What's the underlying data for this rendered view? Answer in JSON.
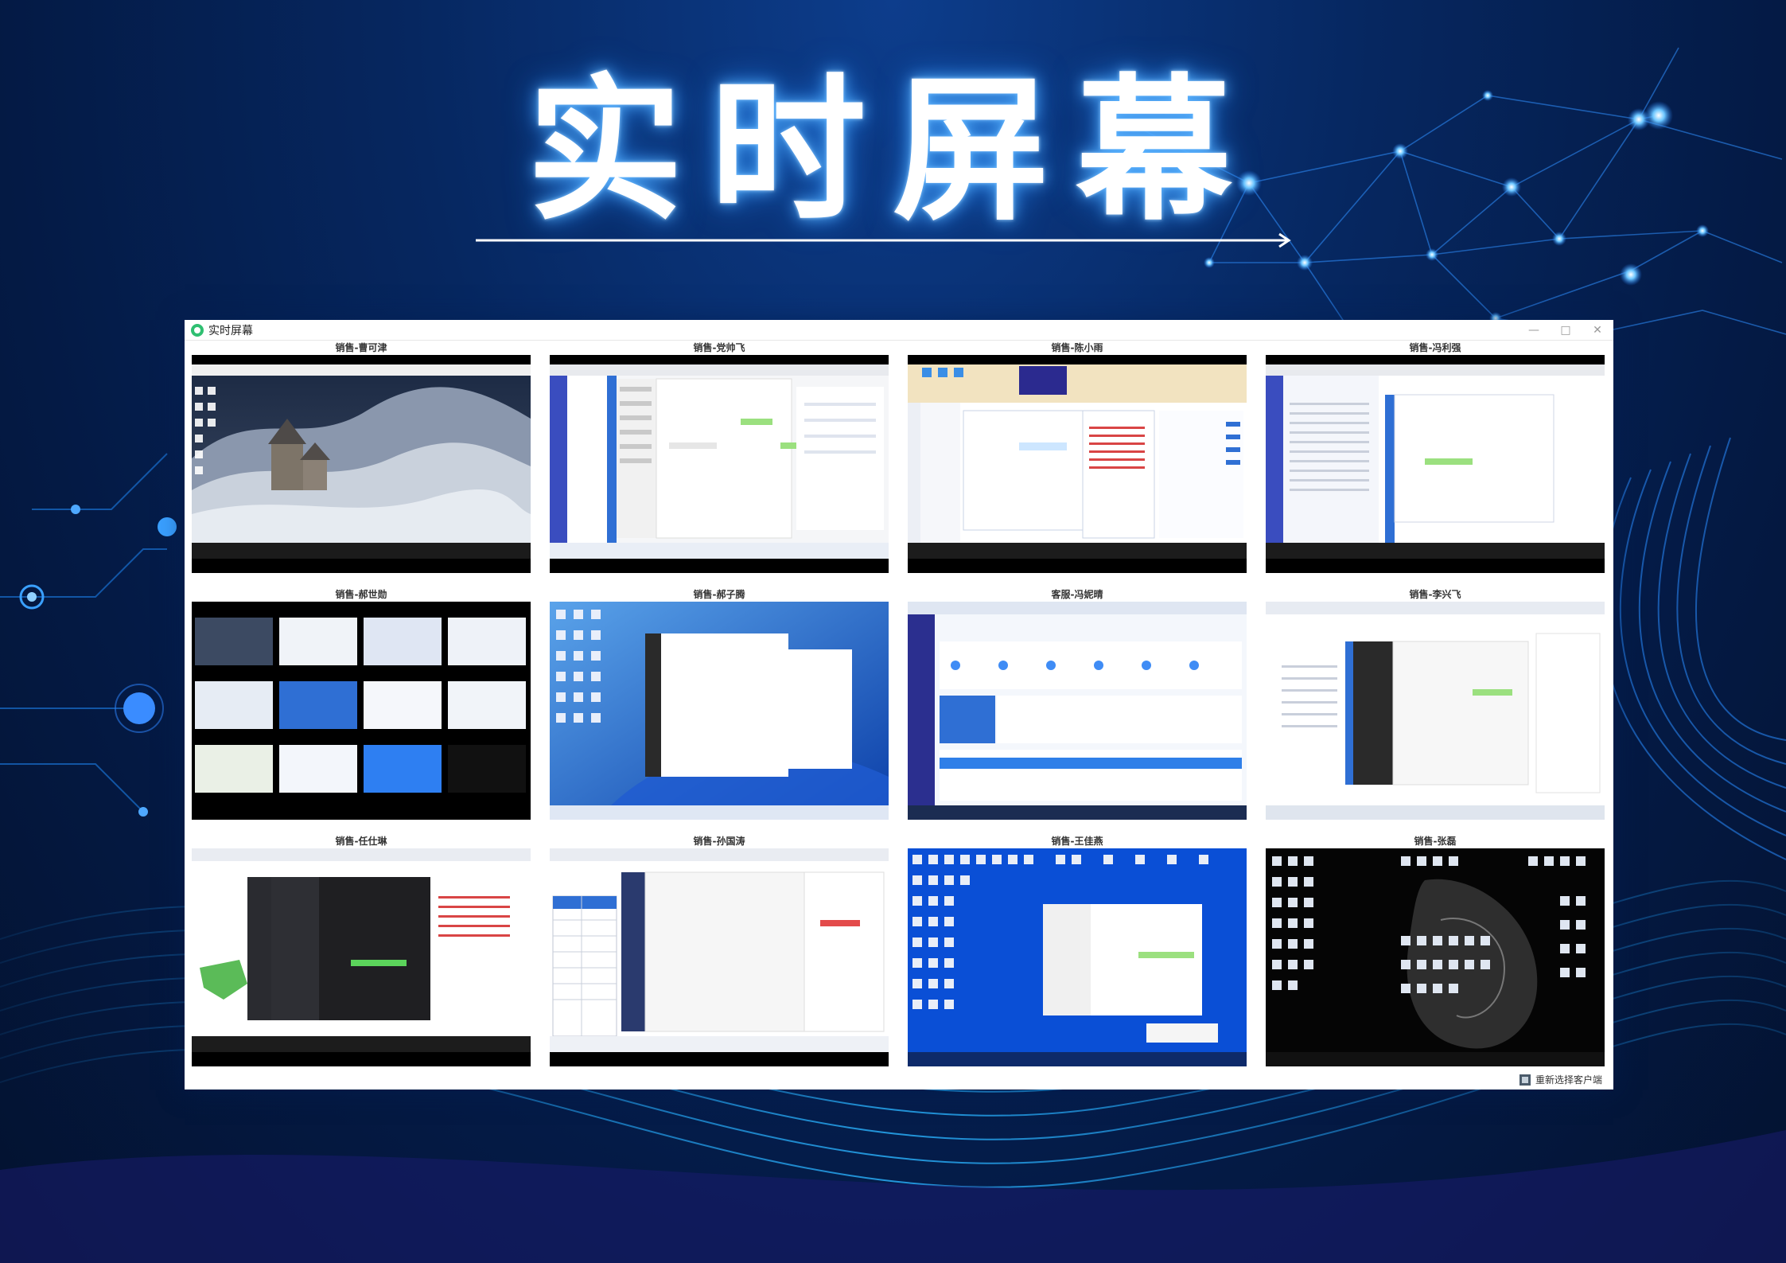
{
  "hero": {
    "title": "实时屏幕"
  },
  "window": {
    "title": "实时屏幕",
    "controls": {
      "minimize": "—",
      "maximize": "□",
      "close": "✕"
    },
    "footer_button": "重新选择客户端"
  },
  "screens": [
    {
      "label": "销售-曹可津",
      "kind": "photo"
    },
    {
      "label": "销售-党帅飞",
      "kind": "chat"
    },
    {
      "label": "销售-陈小雨",
      "kind": "crm"
    },
    {
      "label": "销售-冯利强",
      "kind": "table"
    },
    {
      "label": "销售-郝世勋",
      "kind": "multi"
    },
    {
      "label": "销售-郝子腾",
      "kind": "desktop-win11"
    },
    {
      "label": "客服-冯妮晴",
      "kind": "dashboard"
    },
    {
      "label": "销售-李兴飞",
      "kind": "doc"
    },
    {
      "label": "销售-任仕琳",
      "kind": "dark-chat"
    },
    {
      "label": "销售-孙国涛",
      "kind": "sheet"
    },
    {
      "label": "销售-王佳燕",
      "kind": "desktop-blue"
    },
    {
      "label": "销售-张磊",
      "kind": "desktop-dark"
    }
  ],
  "colors": {
    "accent": "#2fbf71",
    "glow": "#4fb0ff",
    "background": "#062760"
  }
}
